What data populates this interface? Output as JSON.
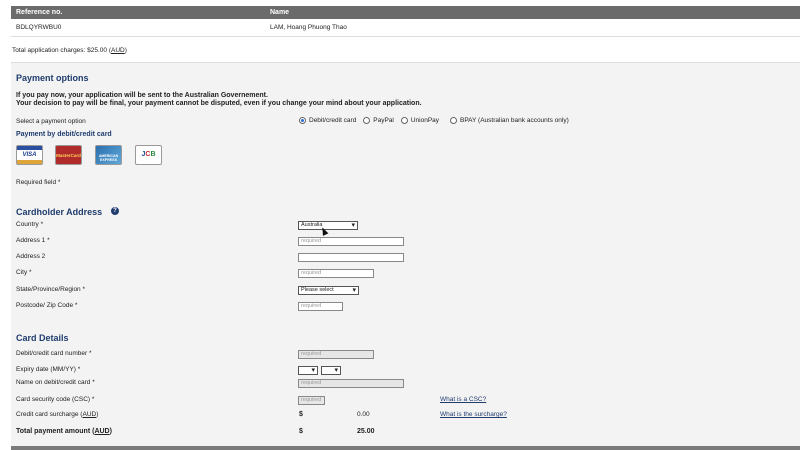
{
  "reference_table": {
    "col_reference": "Reference no.",
    "col_name": "Name",
    "reference_value": "BDLQYRWBU0",
    "name_value": "LAM, Hoang Phuong Thao"
  },
  "charges": {
    "prefix": "Total application charges: $25.00 (",
    "currency": "AUD",
    "suffix": ")"
  },
  "payment_options": {
    "title": "Payment options",
    "warning_1": "If you pay now, your application will be sent to the Australian Governement.",
    "warning_2": "Your decision to pay will be final, your payment cannot be disputed, even if you change your mind about your application.",
    "select_label": "Select a payment option",
    "options": [
      {
        "label": "Debit/credit card",
        "selected": true
      },
      {
        "label": "PayPal",
        "selected": false
      },
      {
        "label": "UnionPay",
        "selected": false
      },
      {
        "label": "BPAY (Australian bank accounts only)",
        "selected": false
      }
    ],
    "by_card_title": "Payment by debit/credit card",
    "cards": {
      "visa": "VISA",
      "mastercard": "MasterCard",
      "amex": "AMERICAN EXPRESS",
      "jcb_1": "J",
      "jcb_2": "C",
      "jcb_3": "B"
    },
    "required_note": "Required field *"
  },
  "cardholder": {
    "title": "Cardholder Address",
    "help_icon": "question-circle-icon",
    "country_label": "Country *",
    "country_value": "Australia",
    "address1_label": "Address 1 *",
    "address1_placeholder": "required",
    "address2_label": "Address 2",
    "city_label": "City *",
    "city_placeholder": "required",
    "state_label": "State/Province/Region *",
    "state_value": "Please select",
    "postcode_label": "Postcode/ Zip Code *",
    "postcode_placeholder": "required"
  },
  "card_details": {
    "title": "Card Details",
    "number_label": "Debit/credit card number *",
    "number_placeholder": "required",
    "expiry_label": "Expiry date (MM/YY) *",
    "name_label": "Name on debit/credit card *",
    "name_placeholder": "required",
    "csc_label": "Card security code (CSC) *",
    "csc_placeholder": "required",
    "csc_link": "What is a CSC?",
    "surcharge_label_prefix": "Credit card surcharge (",
    "surcharge_currency": "AUD",
    "surcharge_label_suffix": ")",
    "surcharge_symbol": "$",
    "surcharge_value": "0.00",
    "surcharge_link": "What is the surcharge?",
    "total_label_prefix": "Total payment amount (",
    "total_currency": "AUD",
    "total_label_suffix": ")",
    "total_symbol": "$",
    "total_value": "25.00"
  },
  "colors": {
    "heading": "#1f3c6e",
    "table_header": "#6b6b6b",
    "panel_bg": "#f3f3f3"
  }
}
